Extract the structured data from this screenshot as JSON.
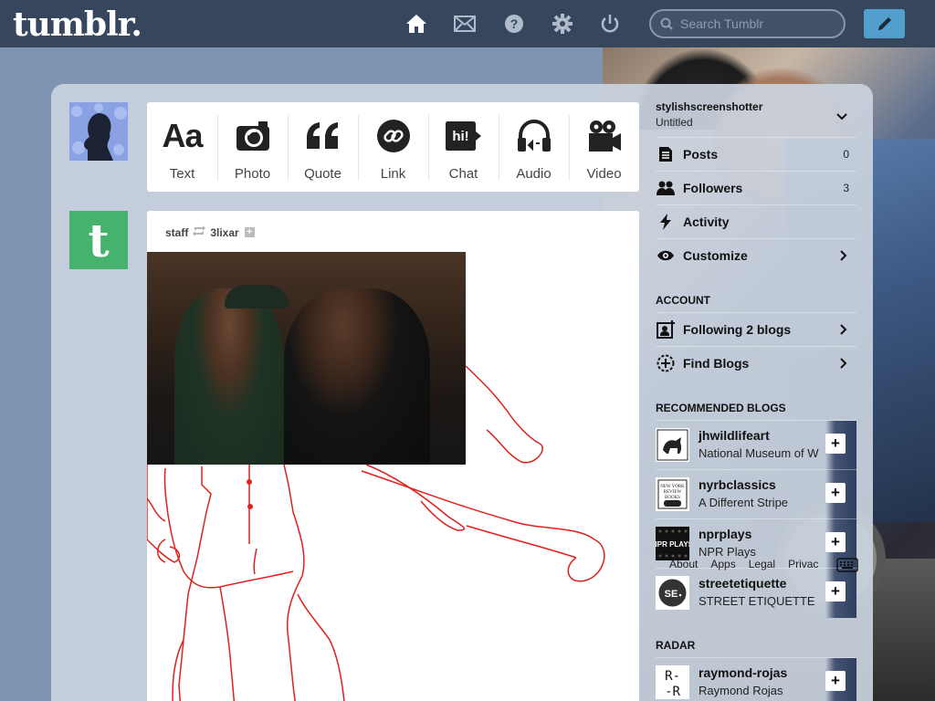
{
  "header": {
    "logo": "tumblr.",
    "search_placeholder": "Search Tumblr",
    "nav_icons": [
      "home-icon",
      "mail-icon",
      "help-icon",
      "gear-icon",
      "power-icon"
    ],
    "compose_icon": "pencil-icon"
  },
  "post_types": [
    {
      "label": "Text",
      "icon": "text-icon",
      "glyph": "Aa"
    },
    {
      "label": "Photo",
      "icon": "camera-icon"
    },
    {
      "label": "Quote",
      "icon": "quote-icon",
      "glyph": "“"
    },
    {
      "label": "Link",
      "icon": "link-icon"
    },
    {
      "label": "Chat",
      "icon": "chat-icon",
      "glyph": "hi!"
    },
    {
      "label": "Audio",
      "icon": "headphones-icon"
    },
    {
      "label": "Video",
      "icon": "video-camera-icon"
    }
  ],
  "post": {
    "author": "staff",
    "reblogged_from": "3lixar"
  },
  "sidebar": {
    "blog_name": "stylishscreenshotter",
    "blog_title": "Untitled",
    "items": [
      {
        "label": "Posts",
        "count": "0"
      },
      {
        "label": "Followers",
        "count": "3"
      },
      {
        "label": "Activity"
      },
      {
        "label": "Customize"
      }
    ],
    "account_header": "ACCOUNT",
    "account_items": [
      {
        "label": "Following 2 blogs"
      },
      {
        "label": "Find Blogs"
      }
    ],
    "recommended_header": "RECOMMENDED BLOGS",
    "recommended": [
      {
        "name": "jhwildlifeart",
        "desc": "National Museum of W"
      },
      {
        "name": "nyrbclassics",
        "desc": "A Different Stripe"
      },
      {
        "name": "nprplays",
        "desc": "NPR Plays"
      },
      {
        "name": "streetetiquette",
        "desc": "STREET ETIQUETTE"
      }
    ],
    "radar_header": "RADAR",
    "radar": [
      {
        "name": "raymond-rojas",
        "desc": "Raymond Rojas"
      }
    ],
    "footer_links": [
      "About",
      "Apps",
      "Legal",
      "Privac"
    ]
  },
  "colors": {
    "topbar": "#36465d",
    "accent": "#529ecc",
    "background": "#7f93b3",
    "staff_avatar": "#45b26e"
  }
}
